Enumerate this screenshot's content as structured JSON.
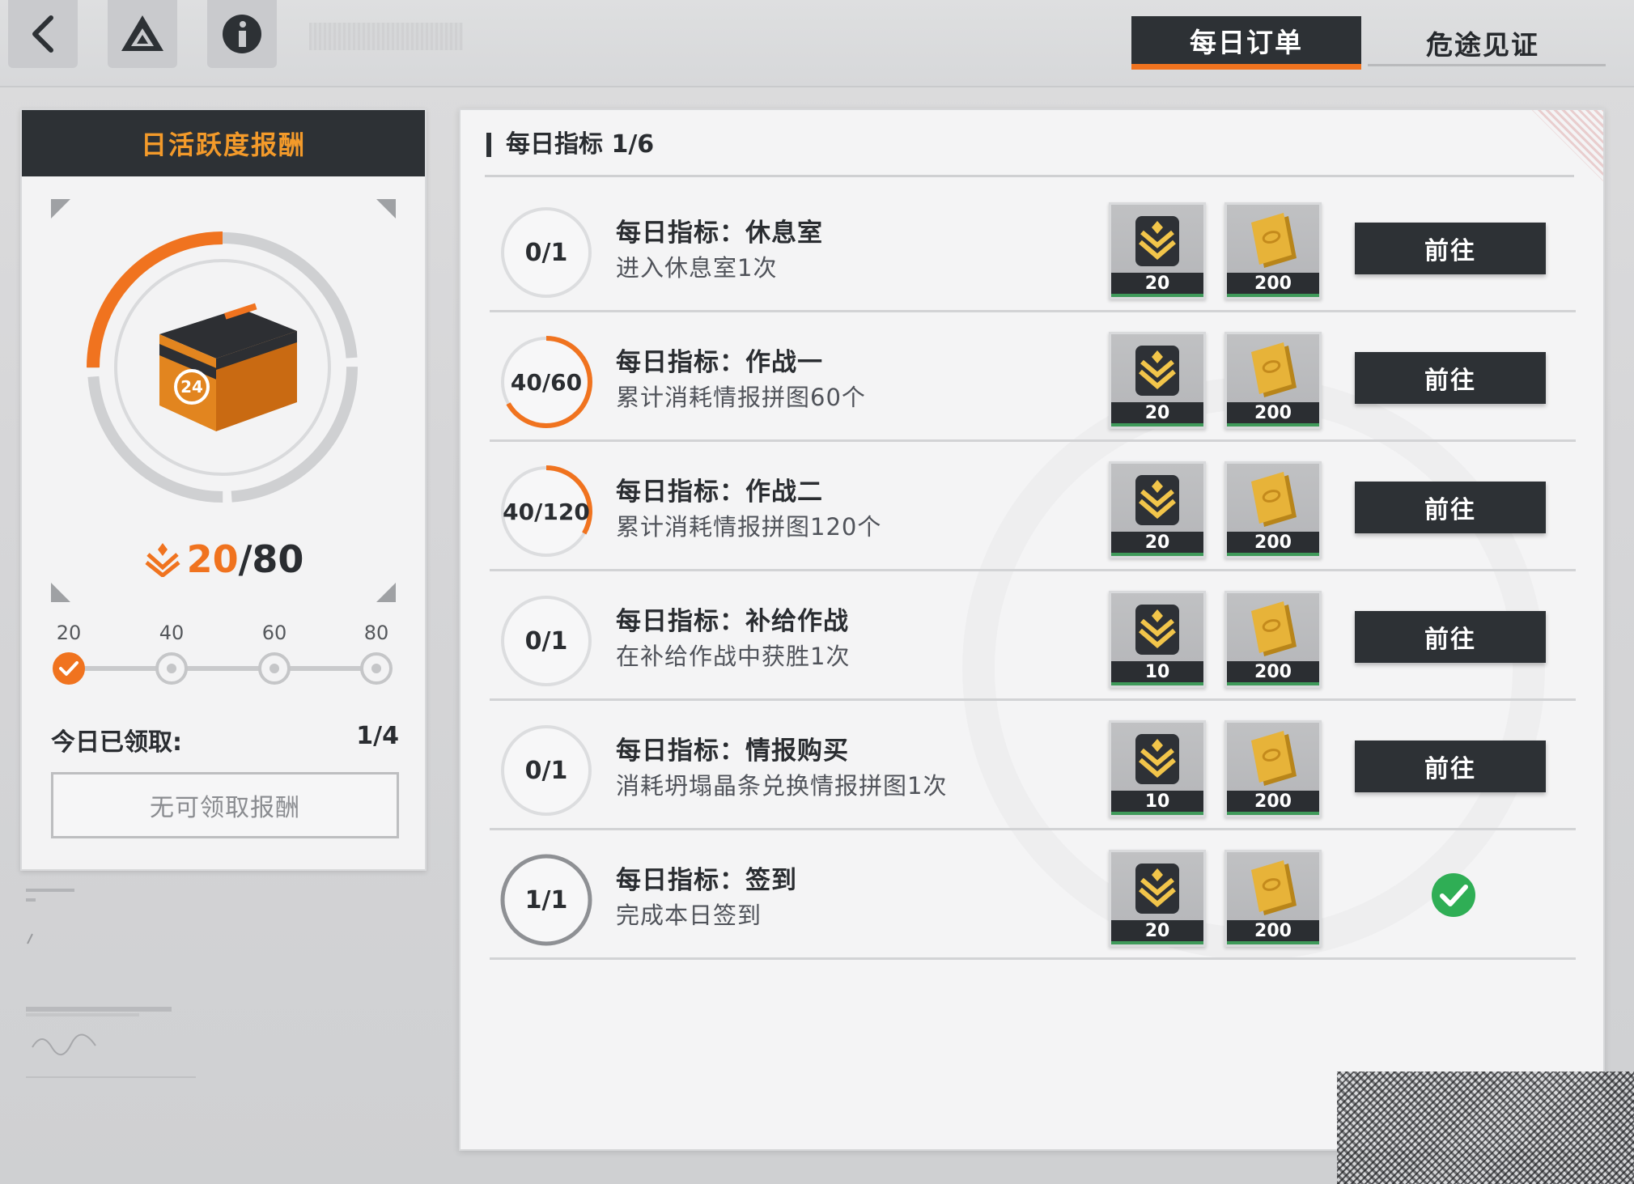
{
  "header": {
    "tabs": [
      {
        "label": "每日订单",
        "active": true
      },
      {
        "label": "危途见证",
        "active": false
      }
    ]
  },
  "left_panel": {
    "title": "日活跃度报酬",
    "score": {
      "current": "20",
      "separator": "/",
      "total": "80"
    },
    "progress_fraction": 0.25,
    "milestones": [
      {
        "label": "20",
        "done": true
      },
      {
        "label": "40",
        "done": false
      },
      {
        "label": "60",
        "done": false
      },
      {
        "label": "80",
        "done": false
      }
    ],
    "claimed_label": "今日已领取:",
    "claimed_value": "1/4",
    "claim_button": "无可领取报酬"
  },
  "main_panel": {
    "title": "每日指标 1/6",
    "go_label": "前往",
    "tasks": [
      {
        "title": "每日指标：休息室",
        "desc": "进入休息室1次",
        "progress": "0/1",
        "fraction": 0,
        "rewards": [
          "20",
          "200"
        ],
        "completed": false
      },
      {
        "title": "每日指标：作战一",
        "desc": "累计消耗情报拼图60个",
        "progress": "40/60",
        "fraction": 0.667,
        "rewards": [
          "20",
          "200"
        ],
        "completed": false
      },
      {
        "title": "每日指标：作战二",
        "desc": "累计消耗情报拼图120个",
        "progress": "40/120",
        "fraction": 0.333,
        "rewards": [
          "20",
          "200"
        ],
        "completed": false
      },
      {
        "title": "每日指标：补给作战",
        "desc": "在补给作战中获胜1次",
        "progress": "0/1",
        "fraction": 0,
        "rewards": [
          "10",
          "200"
        ],
        "completed": false
      },
      {
        "title": "每日指标：情报购买",
        "desc": "消耗坍塌晶条兑换情报拼图1次",
        "progress": "0/1",
        "fraction": 0,
        "rewards": [
          "10",
          "200"
        ],
        "completed": false
      },
      {
        "title": "每日指标：签到",
        "desc": "完成本日签到",
        "progress": "1/1",
        "fraction": 1,
        "rewards": [
          "20",
          "200"
        ],
        "completed": true
      }
    ]
  },
  "colors": {
    "accent": "#f0731f",
    "dark": "#2d3135",
    "success": "#2fae55"
  }
}
